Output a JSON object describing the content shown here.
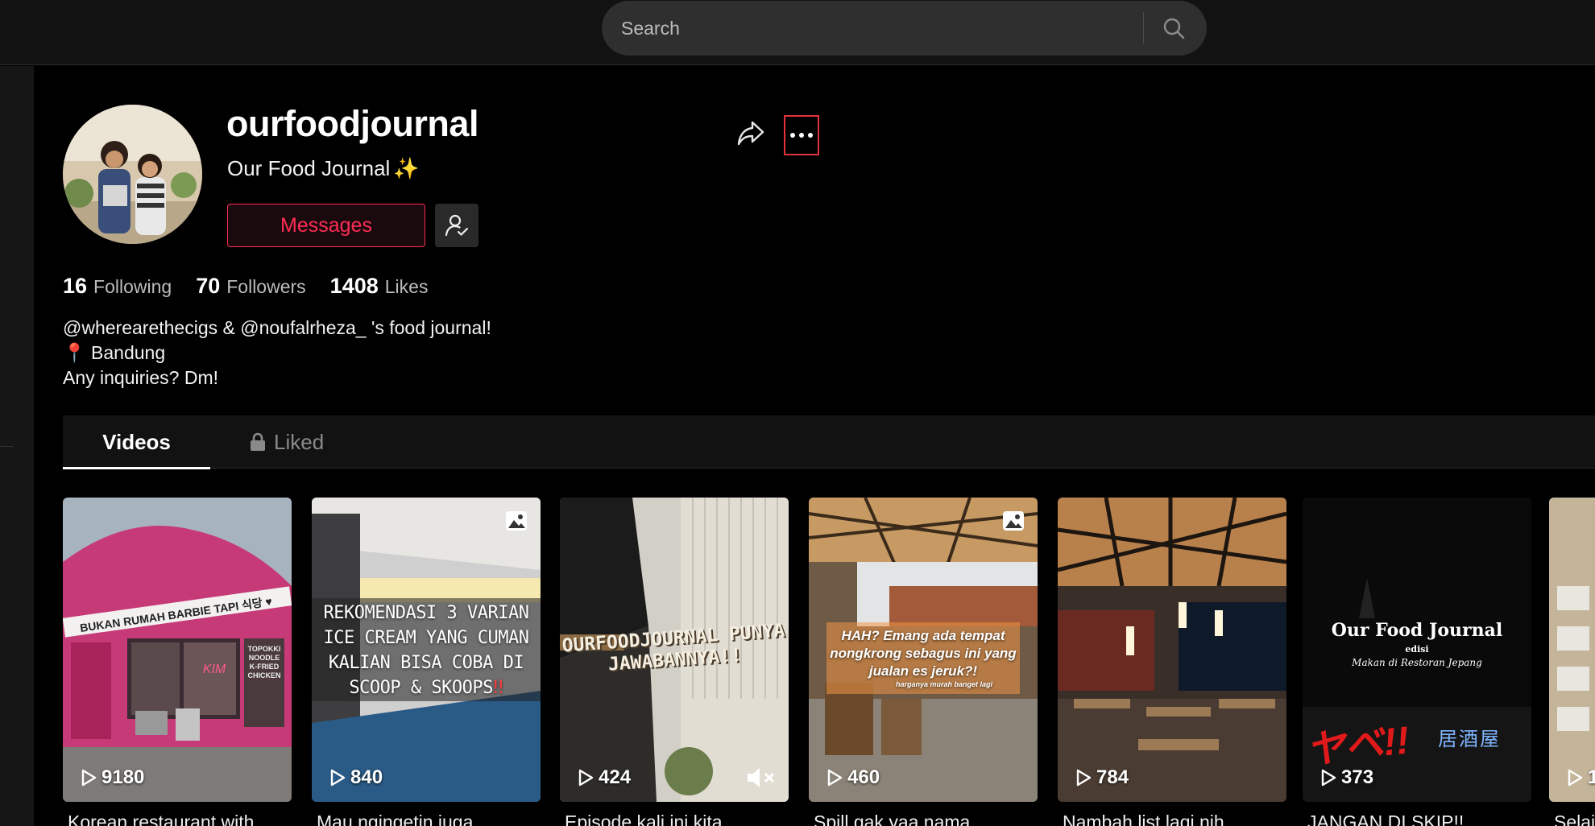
{
  "search": {
    "placeholder": "Search"
  },
  "profile": {
    "username": "ourfoodjournal",
    "display_name": "Our Food Journal",
    "display_emoji": "✨",
    "messages_label": "Messages",
    "following_count": "16",
    "following_label": "Following",
    "followers_count": "70",
    "followers_label": "Followers",
    "likes_count": "1408",
    "likes_label": "Likes",
    "bio_line1": "@wherearethecigs & @noufalrheza_ 's food journal!",
    "bio_line2": "Bandung",
    "bio_line3": "Any inquiries? Dm!"
  },
  "tabs": [
    {
      "label": "Videos",
      "active": true
    },
    {
      "label": "Liked",
      "locked": true
    }
  ],
  "colors": {
    "accent": "#fe2c55",
    "highlight_border": "#e5333d"
  },
  "videos": [
    {
      "views": "9180",
      "caption": "Korean restaurant with",
      "overlay": "BUKAN RUMAH BARBIE TAPI 식당 ♥",
      "shop_sign": "TOPOKKI NOODLE K-FRIED CHICKEN",
      "neon": "KIM"
    },
    {
      "views": "840",
      "caption": "Mau ngingetin juga",
      "overlay": "REKOMENDASI 3 VARIAN ICE CREAM YANG CUMAN KALIAN BISA COBA DI SCOOP & SKOOPS",
      "overlay_mark": "‼",
      "photo": true
    },
    {
      "views": "424",
      "caption": "Episode kali ini kita",
      "overlay": "OURFOODJOURNAL PUNYA JAWABANNYA!!",
      "muted": true
    },
    {
      "views": "460",
      "caption": "Spill gak yaa nama",
      "overlay": "HAH? Emang ada tempat nongkrong sebagus ini yang jualan es jeruk?!",
      "sub_overlay": "harganya murah banget lagi",
      "photo": true
    },
    {
      "views": "784",
      "caption": "Nambah list lagi nih",
      "overlay": ""
    },
    {
      "views": "373",
      "caption": "JANGAN DI SKIP!!",
      "overlay": "Our Food Journal",
      "sub_overlay": "edisi",
      "script_text": "Makan di Restoran Jepang",
      "neon_jp": "ヤベ!!",
      "sign_jp": "居酒屋"
    },
    {
      "views": "1",
      "caption": "Selai",
      "overlay": ""
    }
  ]
}
